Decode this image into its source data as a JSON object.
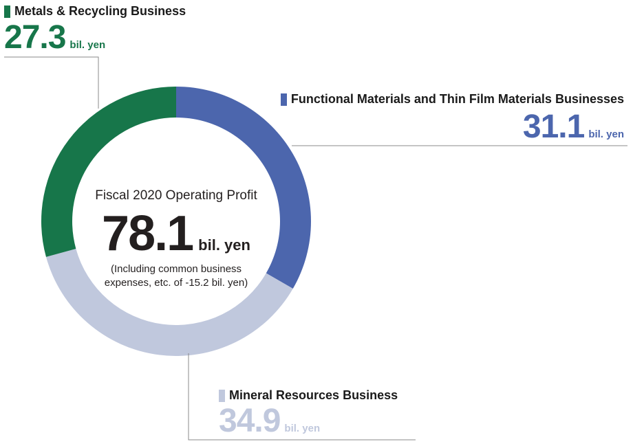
{
  "colors": {
    "metals": "#17764a",
    "functional": "#4c66ad",
    "mineral": "#c0c8dd",
    "leader": "#8a8a8a",
    "text": "#231f1f"
  },
  "center": {
    "title": "Fiscal 2020 Operating Profit",
    "value": "78.1",
    "unit": "bil. yen",
    "note_line1": "(Including common business",
    "note_line2": "expenses, etc. of -15.2 bil. yen)"
  },
  "chart_data": {
    "type": "pie",
    "style": "donut",
    "start_angle_deg": 0,
    "direction": "clockwise",
    "segments": [
      {
        "key": "functional",
        "name": "Functional Materials and Thin Film Materials Businesses",
        "value": 31.1,
        "value_label": "31.1",
        "unit": "bil. yen"
      },
      {
        "key": "mineral",
        "name": "Mineral Resources Business",
        "value": 34.9,
        "value_label": "34.9",
        "unit": "bil. yen"
      },
      {
        "key": "metals",
        "name": "Metals & Recycling Business",
        "value": 27.3,
        "value_label": "27.3",
        "unit": "bil. yen"
      }
    ]
  }
}
